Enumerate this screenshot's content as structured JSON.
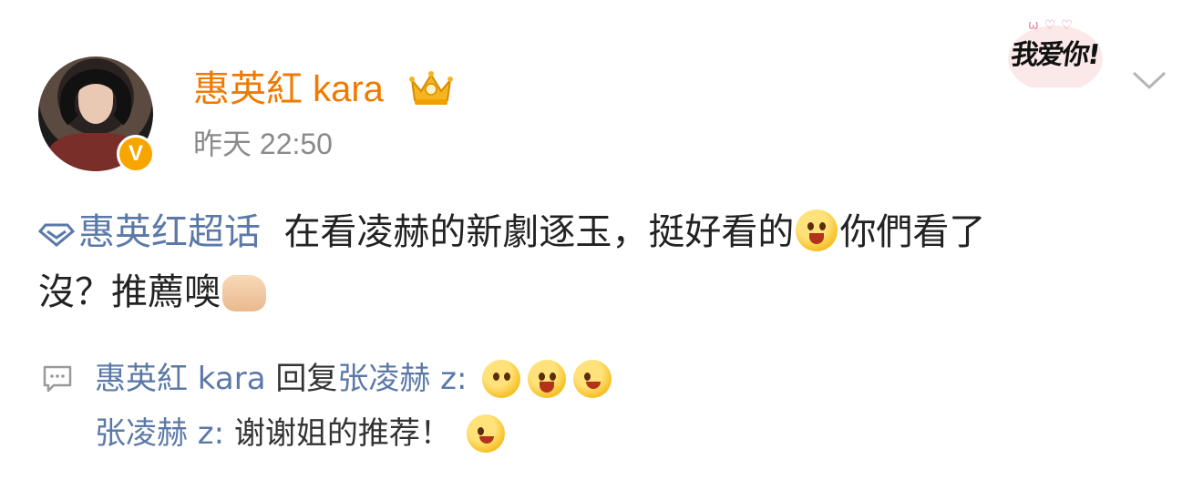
{
  "post": {
    "author": {
      "name": "惠英紅 kara",
      "verified_badge": "V",
      "avatar_icon": "avatar-photo"
    },
    "timestamp": "昨天 22:50",
    "sticker_text": "我爱你!",
    "sticker_hearts": "ω♡♡",
    "topic": "惠英红超话",
    "body_line1": "在看凌赫的新劇逐玉，挺好看的",
    "body_mid": "你們看了",
    "body_line2": "沒？推薦噢"
  },
  "comments": [
    {
      "author": "惠英紅 kara",
      "action": "回复",
      "reply_to": "张凌赫 z:",
      "text": ""
    },
    {
      "author": "张凌赫 z:",
      "text": " 谢谢姐的推荐！"
    }
  ],
  "colors": {
    "username": "#f07a00",
    "link": "#5b79a8",
    "timestamp": "#8a8a8a",
    "verified": "#f7a600"
  }
}
